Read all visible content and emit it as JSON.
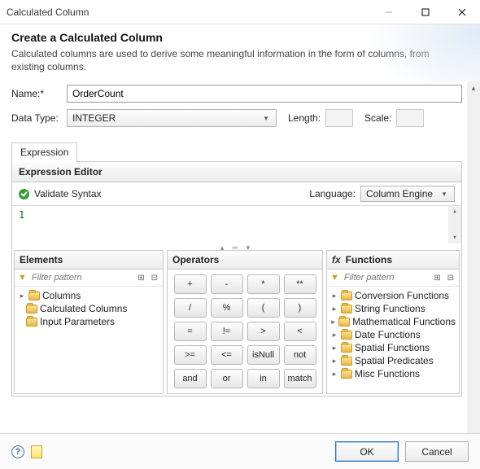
{
  "window": {
    "title": "Calculated Column"
  },
  "header": {
    "title": "Create a Calculated Column",
    "desc": "Calculated columns are used to derive some meaningful information in the form of columns, from existing columns."
  },
  "form": {
    "name_label": "Name:*",
    "name_value": "OrderCount",
    "datatype_label": "Data Type:",
    "datatype_value": "INTEGER",
    "length_label": "Length:",
    "scale_label": "Scale:"
  },
  "tab": {
    "expression": "Expression"
  },
  "editor": {
    "title": "Expression Editor",
    "validate": "Validate Syntax",
    "language_label": "Language:",
    "language_value": "Column Engine",
    "expr": "1"
  },
  "elements": {
    "title": "Elements",
    "filter_placeholder": "Filter pattern",
    "items": [
      "Columns",
      "Calculated Columns",
      "Input Parameters"
    ]
  },
  "operators": {
    "title": "Operators",
    "buttons": [
      "+",
      "-",
      "*",
      "**",
      "/",
      "%",
      "(",
      ")",
      "=",
      "!=",
      ">",
      "<",
      ">=",
      "<=",
      "isNull",
      "not",
      "and",
      "or",
      "in",
      "match"
    ]
  },
  "functions": {
    "title": "Functions",
    "filter_placeholder": "Filter pattern",
    "items": [
      "Conversion Functions",
      "String Functions",
      "Mathematical Functions",
      "Date Functions",
      "Spatial Functions",
      "Spatial Predicates",
      "Misc Functions"
    ]
  },
  "buttons": {
    "ok": "OK",
    "cancel": "Cancel"
  }
}
